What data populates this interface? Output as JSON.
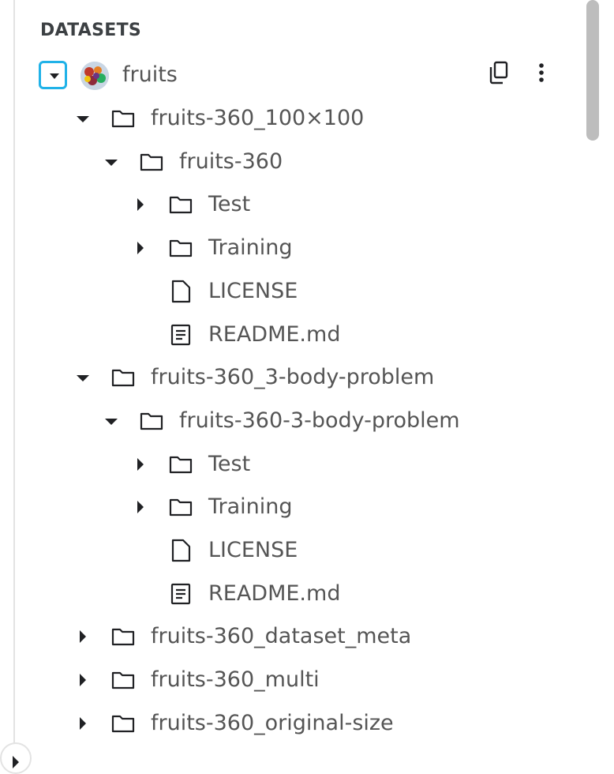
{
  "section": {
    "title": "DATASETS"
  },
  "dataset": {
    "name": "fruits",
    "thumbnail_icon": "fruit-bowl-image",
    "actions": {
      "copy_icon": "copy-icon",
      "more_icon": "more-vert-icon"
    }
  },
  "tree": [
    {
      "label": "fruits-360_100×100",
      "depth": 0,
      "type": "folder",
      "expanded": true,
      "has_children": true
    },
    {
      "label": "fruits-360",
      "depth": 1,
      "type": "folder",
      "expanded": true,
      "has_children": true
    },
    {
      "label": "Test",
      "depth": 2,
      "type": "folder",
      "expanded": false,
      "has_children": true
    },
    {
      "label": "Training",
      "depth": 2,
      "type": "folder",
      "expanded": false,
      "has_children": true
    },
    {
      "label": "LICENSE",
      "depth": 2,
      "type": "file",
      "expanded": false,
      "has_children": false
    },
    {
      "label": "README.md",
      "depth": 2,
      "type": "document",
      "expanded": false,
      "has_children": false
    },
    {
      "label": "fruits-360_3-body-problem",
      "depth": 0,
      "type": "folder",
      "expanded": true,
      "has_children": true
    },
    {
      "label": "fruits-360-3-body-problem",
      "depth": 1,
      "type": "folder",
      "expanded": true,
      "has_children": true
    },
    {
      "label": "Test",
      "depth": 2,
      "type": "folder",
      "expanded": false,
      "has_children": true
    },
    {
      "label": "Training",
      "depth": 2,
      "type": "folder",
      "expanded": false,
      "has_children": true
    },
    {
      "label": "LICENSE",
      "depth": 2,
      "type": "file",
      "expanded": false,
      "has_children": false
    },
    {
      "label": "README.md",
      "depth": 2,
      "type": "document",
      "expanded": false,
      "has_children": false
    },
    {
      "label": "fruits-360_dataset_meta",
      "depth": 0,
      "type": "folder",
      "expanded": false,
      "has_children": true
    },
    {
      "label": "fruits-360_multi",
      "depth": 0,
      "type": "folder",
      "expanded": false,
      "has_children": true
    },
    {
      "label": "fruits-360_original-size",
      "depth": 0,
      "type": "folder",
      "expanded": false,
      "has_children": true
    }
  ],
  "colors": {
    "focus_ring": "#20b2e8",
    "text": "#555555",
    "icon": "#202124",
    "border": "#e3e3e3",
    "scrollbar": "#bdbdbd"
  }
}
